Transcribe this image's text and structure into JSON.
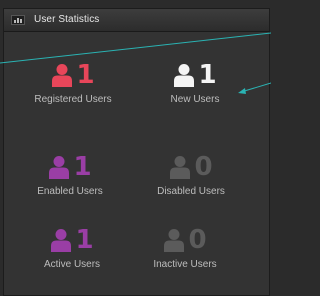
{
  "header": {
    "title": "User Statistics",
    "icon": "chart-icon"
  },
  "stats": [
    {
      "id": "registered",
      "count": "1",
      "label": "Registered Users",
      "color": "#e8465a",
      "icon": "user-icon"
    },
    {
      "id": "new",
      "count": "1",
      "label": "New Users",
      "color": "#f4f4f4",
      "icon": "user-icon"
    },
    {
      "id": "enabled",
      "count": "1",
      "label": "Enabled Users",
      "color": "#9a3ea5",
      "icon": "user-icon"
    },
    {
      "id": "disabled",
      "count": "0",
      "label": "Disabled Users",
      "color": "#5b5b5b",
      "icon": "user-icon"
    },
    {
      "id": "active",
      "count": "1",
      "label": "Active Users",
      "color": "#9a3ea5",
      "icon": "user-icon"
    },
    {
      "id": "inactive",
      "count": "0",
      "label": "Inactive Users",
      "color": "#5b5b5b",
      "icon": "user-icon"
    }
  ],
  "annotation_color": "#2ab3b3"
}
